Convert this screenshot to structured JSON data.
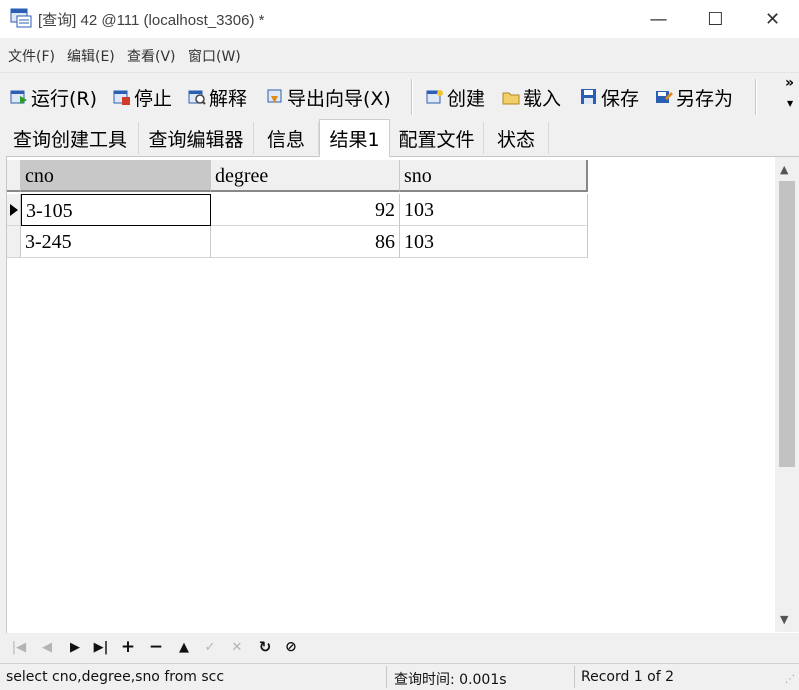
{
  "window": {
    "title": "[查询] 42 @111 (localhost_3306) *",
    "minimize_glyph": "—",
    "maximize_glyph": "☐",
    "close_glyph": "✕"
  },
  "menu": [
    "文件(F)",
    "编辑(E)",
    "查看(V)",
    "窗口(W)"
  ],
  "toolbar": {
    "run": "运行(R)",
    "stop": "停止",
    "explain": "解释",
    "export_wizard": "导出向导(X)",
    "create": "创建",
    "load": "载入",
    "save": "保存",
    "save_as": "另存为",
    "overflow": "»"
  },
  "tabs": [
    "查询创建工具",
    "查询编辑器",
    "信息",
    "结果1",
    "配置文件",
    "状态"
  ],
  "active_tab": "结果1",
  "grid": {
    "columns": [
      "cno",
      "degree",
      "sno"
    ],
    "rows": [
      [
        "3-105",
        "92",
        "103"
      ],
      [
        "3-245",
        "86",
        "103"
      ]
    ]
  },
  "status": {
    "sql": "select cno,degree,sno from scc",
    "query_time": "查询时间: 0.001s",
    "record": "Record 1 of 2"
  },
  "colors": {
    "accent_icon_blue": "#2b5fb4",
    "sorted_header": "#c8c8c8"
  }
}
